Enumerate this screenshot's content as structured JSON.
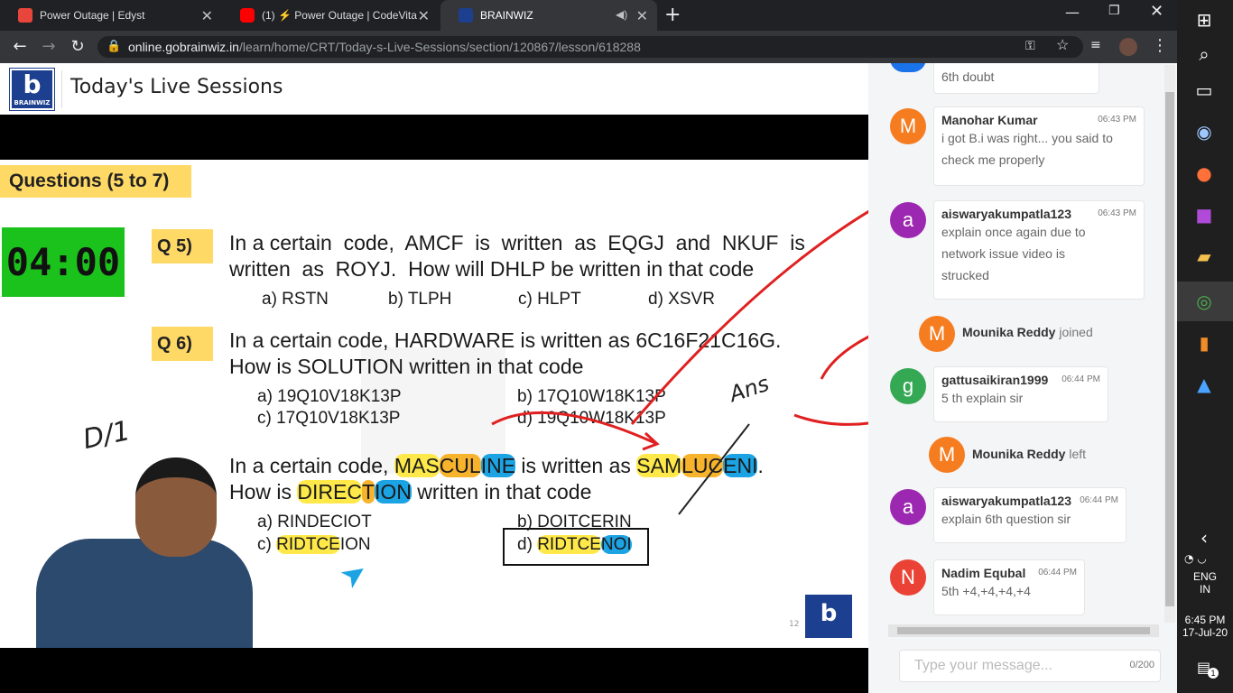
{
  "tabs": [
    {
      "title": "Power Outage | Edyst"
    },
    {
      "title": "(1) ⚡ Power Outage | CodeVita"
    },
    {
      "title": "BRAINWIZ"
    }
  ],
  "url": {
    "host": "online.gobrainwiz.in",
    "path": "/learn/home/CRT/Today-s-Live-Sessions/section/120867/lesson/618288"
  },
  "page": {
    "title": "Today's Live Sessions",
    "logo_text": "BRAINWIZ"
  },
  "slide": {
    "header": "Questions (5 to 7)",
    "timer": "04:00",
    "q5": {
      "label": "Q 5)",
      "line1": "In a certain  code,  AMCF  is  written  as  EQGJ  and  NKUF  is",
      "line2": "written  as  ROYJ.  How will DHLP be written in that code",
      "opts": [
        "a) RSTN",
        "b) TLPH",
        "c) HLPT",
        "d) XSVR"
      ]
    },
    "q6": {
      "label": "Q 6)",
      "line1": "In a certain code, HARDWARE is written as 6C16F21C16G.",
      "line2": "How is SOLUTION written in that code",
      "opts": [
        "a) 19Q10V18K13P",
        "b) 17Q10W18K13P",
        "c) 17Q10V18K13P",
        "d) 19Q10W18K13P"
      ]
    },
    "q7": {
      "line1a": "In a certain code, ",
      "w1a": "MAS",
      "w1b": "CUL",
      "w1c": "INE",
      "line1b": " is written as ",
      "w2a": "SAM",
      "w2b": "LUC",
      "w2c": "ENI",
      "w2d": ".",
      "line2a": "How is ",
      "w3a": "DIREC",
      "w3b": "T",
      "w3c": "ION",
      "line2b": " written in that code",
      "opt_a": "a) RINDECIOT",
      "opt_b": "b) DOITCERIN",
      "opt_c1": "c) ",
      "opt_c2": "RIDTCE",
      "opt_c3": "ION",
      "opt_d1": "d) ",
      "opt_d2": "RIDTCE",
      "opt_d3": "NOI"
    },
    "annot_d1": "D/1",
    "annot_ans": "Ans",
    "page_num": "12"
  },
  "chat": {
    "messages": [
      {
        "initial": "",
        "name": "",
        "time": "",
        "text": "6th doubt",
        "color": "#1a73e8"
      },
      {
        "initial": "M",
        "name": "Manohar Kumar",
        "time": "06:43 PM",
        "text1": "i got B.i was right... you said to",
        "text2": "check me properly",
        "color": "#f57c1f"
      },
      {
        "initial": "a",
        "name": "aiswaryakumpatla123",
        "time": "06:43 PM",
        "text1": "explain once again due to",
        "text2": "network issue video is",
        "text3": "strucked",
        "color": "#9c27b0"
      },
      {
        "initial": "M",
        "name": "Mounika Reddy",
        "status": "joined",
        "color": "#f57c1f"
      },
      {
        "initial": "g",
        "name": "gattusaikiran1999",
        "time": "06:44 PM",
        "text1": "5 th explain sir",
        "color": "#34a853"
      },
      {
        "initial": "M",
        "name": "Mounika Reddy",
        "status": "left",
        "color": "#f57c1f"
      },
      {
        "initial": "a",
        "name": "aiswaryakumpatla123",
        "time": "06:44 PM",
        "text1": "explain 6th question sir",
        "color": "#9c27b0"
      },
      {
        "initial": "N",
        "name": "Nadim Equbal",
        "time": "06:44 PM",
        "text1": "5th +4,+4,+4,+4",
        "color": "#ea4335"
      }
    ],
    "input_placeholder": "Type your message...",
    "counter": "0/200"
  },
  "taskbar": {
    "lang1": "ENG",
    "lang2": "IN",
    "time": "6:45 PM",
    "date": "17-Jul-20",
    "notif_count": "1"
  }
}
